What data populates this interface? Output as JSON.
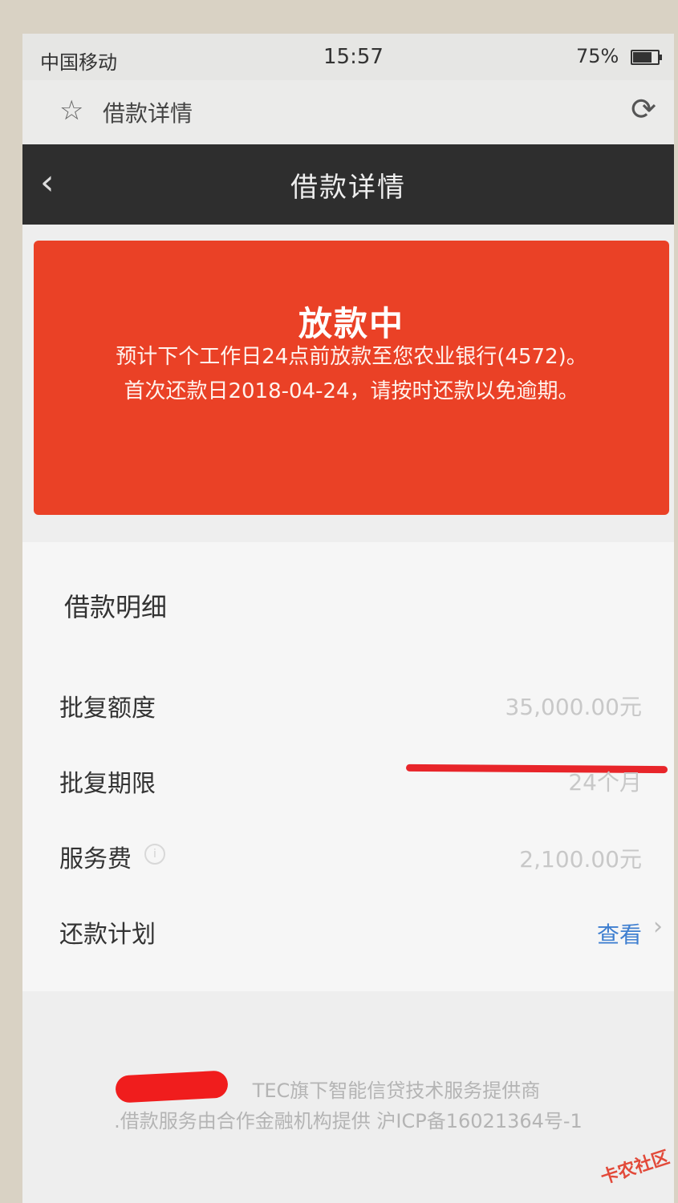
{
  "status_bar": {
    "carrier": "中国移动",
    "time": "15:57",
    "battery": "75%",
    "battery_level": 0.75
  },
  "browser": {
    "title": "借款详情",
    "bookmark_icon": "star-icon",
    "refresh_icon": "refresh-icon"
  },
  "nav": {
    "title": "借款详情",
    "back_icon": "chevron-left-icon"
  },
  "status_card": {
    "title": "放款中",
    "description": "预计下个工作日24点前放款至您农业银行(4572)。首次还款日2018-04-24，请按时还款以免逾期。",
    "color": "#ea4126"
  },
  "details": {
    "section_title": "借款明细",
    "rows": [
      {
        "label": "批复额度",
        "value": "35,000.00元"
      },
      {
        "label": "批复期限",
        "value": "24个月"
      },
      {
        "label": "服务费",
        "value": "2,100.00元"
      },
      {
        "label": "还款计划",
        "value": "查看"
      }
    ]
  },
  "footer": {
    "line1": "TEC旗下智能信贷技术服务提供商",
    "line2": ".借款服务由合作金融机构提供 沪ICP备16021364号-1"
  },
  "watermark": "卡农社区"
}
